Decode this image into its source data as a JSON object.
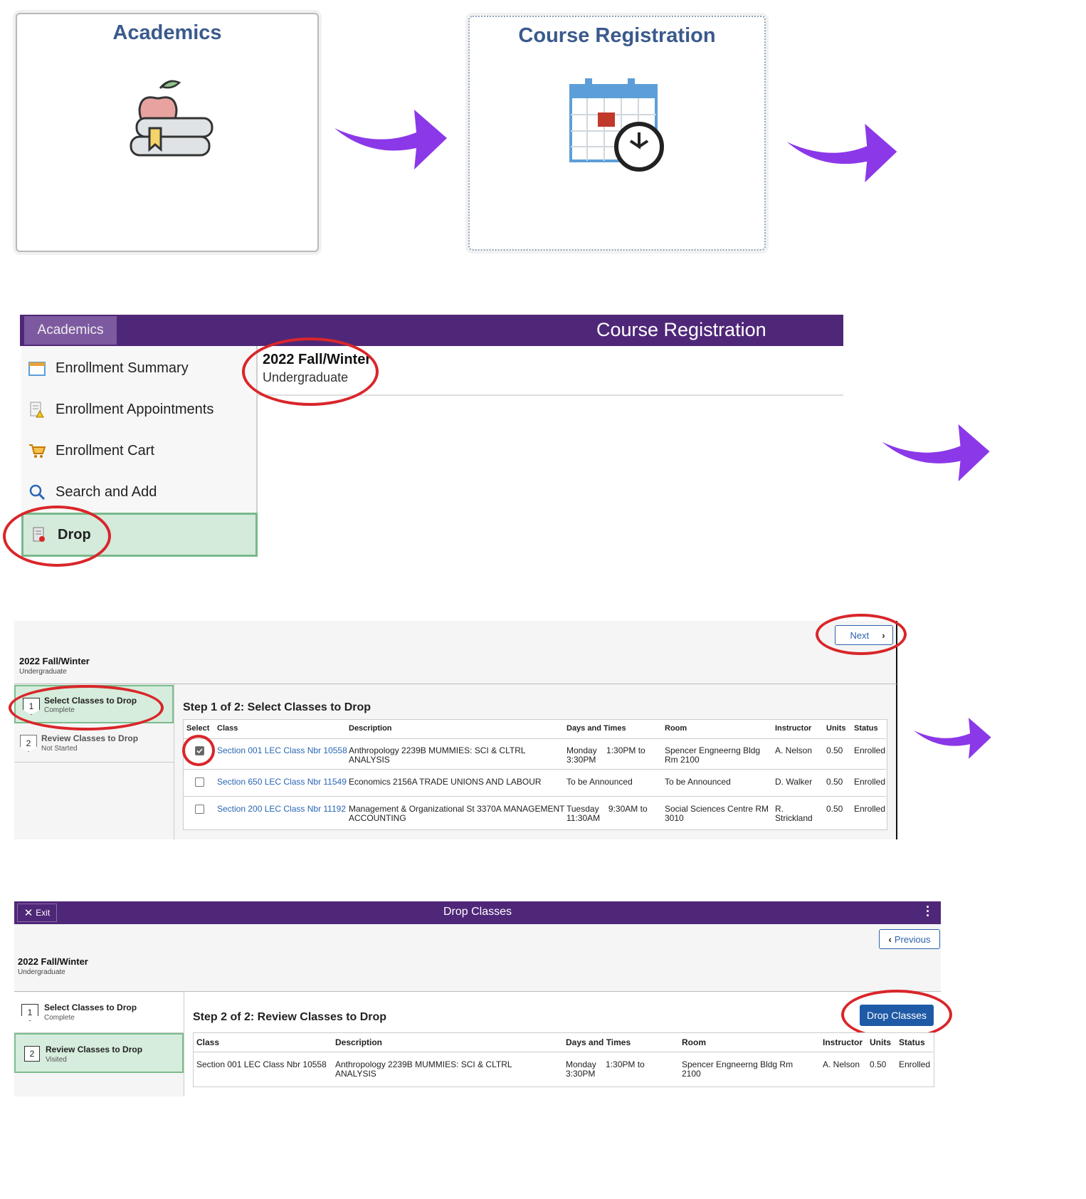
{
  "colors": {
    "purple": "#4f2778",
    "arrow": "#8b38e8",
    "highlight_red": "#d9262a",
    "step_green": "#d6ecdc",
    "link_blue": "#2a66b4"
  },
  "tiles": {
    "academics": {
      "title": "Academics",
      "icon": "apple-on-books-icon"
    },
    "course_registration": {
      "title": "Course Registration",
      "icon": "calendar-clock-icon"
    }
  },
  "course_registration": {
    "tab_label": "Academics",
    "header_title": "Course Registration",
    "term": "2022 Fall/Winter",
    "career": "Undergraduate",
    "menu": [
      {
        "label": "Enrollment Summary",
        "icon": "calendar-icon"
      },
      {
        "label": "Enrollment Appointments",
        "icon": "document-alert-icon"
      },
      {
        "label": "Enrollment Cart",
        "icon": "cart-icon"
      },
      {
        "label": "Search and Add",
        "icon": "search-icon"
      },
      {
        "label": "Drop",
        "icon": "drop-document-icon"
      }
    ]
  },
  "step1": {
    "next_label": "Next",
    "term": "2022 Fall/Winter",
    "career": "Undergraduate",
    "steps": [
      {
        "num": "1",
        "title": "Select Classes to Drop",
        "status": "Complete"
      },
      {
        "num": "2",
        "title": "Review Classes to Drop",
        "status": "Not Started"
      }
    ],
    "heading": "Step 1 of 2: Select Classes to Drop",
    "columns": [
      "Select",
      "Class",
      "Description",
      "Days and Times",
      "Room",
      "Instructor",
      "Units",
      "Status"
    ],
    "rows": [
      {
        "checked": true,
        "class": "Section 001 LEC Class Nbr 10558",
        "desc1": "Anthropology 2239B  MUMMIES: SCI & CLTRL",
        "desc2": "ANALYSIS",
        "days1": "Monday    1:30PM to",
        "days2": "3:30PM",
        "room1": "Spencer Engneerng Bldg",
        "room2": "Rm 2100",
        "instr1": "A. Nelson",
        "instr2": "",
        "units": "0.50",
        "status": "Enrolled"
      },
      {
        "checked": false,
        "class": "Section 650 LEC Class Nbr 11549",
        "desc1": "Economics 2156A  TRADE UNIONS AND LABOUR",
        "desc2": "",
        "days1": "To be Announced",
        "days2": "",
        "room1": "To be Announced",
        "room2": "",
        "instr1": "D. Walker",
        "instr2": "",
        "units": "0.50",
        "status": "Enrolled"
      },
      {
        "checked": false,
        "class": "Section 200 LEC Class Nbr 11192",
        "desc1": "Management & Organizational St 3370A  MANAGEMENT",
        "desc2": "ACCOUNTING",
        "days1": "Tuesday    9:30AM to",
        "days2": "11:30AM",
        "room1": "Social Sciences Centre RM",
        "room2": "3010",
        "instr1": "R.",
        "instr2": "Strickland",
        "units": "0.50",
        "status": "Enrolled"
      }
    ]
  },
  "step2": {
    "exit_label": "Exit",
    "header_title": "Drop Classes",
    "previous_label": "Previous",
    "term": "2022 Fall/Winter",
    "career": "Undergraduate",
    "steps": [
      {
        "num": "1",
        "title": "Select Classes to Drop",
        "status": "Complete"
      },
      {
        "num": "2",
        "title": "Review Classes to Drop",
        "status": "Visited"
      }
    ],
    "heading": "Step 2 of 2: Review Classes to Drop",
    "drop_button": "Drop Classes",
    "columns": [
      "Class",
      "Description",
      "Days and Times",
      "Room",
      "Instructor",
      "Units",
      "Status"
    ],
    "row": {
      "class": "Section 001 LEC Class Nbr 10558",
      "desc1": "Anthropology 2239B  MUMMIES: SCI & CLTRL",
      "desc2": "ANALYSIS",
      "days1": "Monday    1:30PM to",
      "days2": "3:30PM",
      "room1": "Spencer Engneerng Bldg Rm",
      "room2": "2100",
      "instr": "A. Nelson",
      "units": "0.50",
      "status": "Enrolled"
    }
  }
}
